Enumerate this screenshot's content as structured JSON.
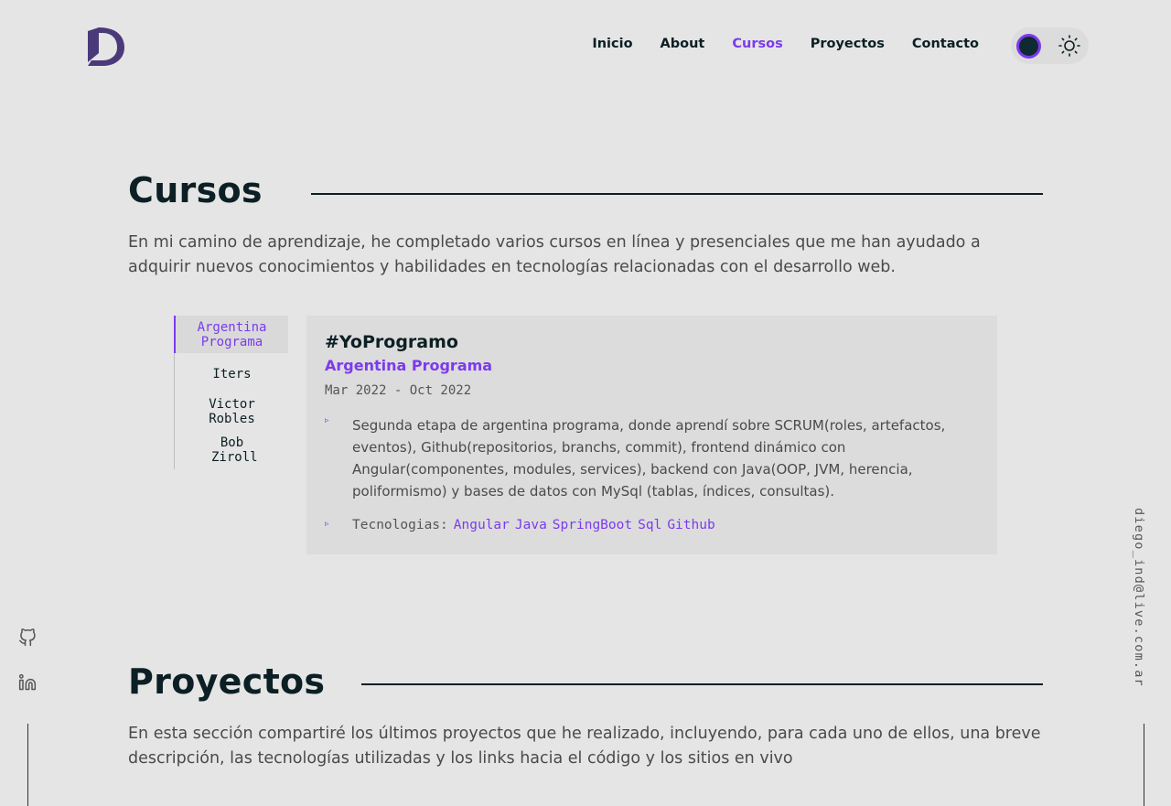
{
  "nav": {
    "items": [
      {
        "label": "Inicio"
      },
      {
        "label": "About"
      },
      {
        "label": "Cursos",
        "active": true
      },
      {
        "label": "Proyectos"
      },
      {
        "label": "Contacto"
      }
    ]
  },
  "theme": {
    "icon": "sun-icon",
    "knob_color": "#0e2a33",
    "accent": "#7c3aed"
  },
  "cursos": {
    "title": "Cursos",
    "description": "En mi camino de aprendizaje, he completado varios cursos en línea y presenciales que me han ayudado a adquirir nuevos conocimientos y habilidades en tecnologías relacionadas con el desarrollo web.",
    "tabs": [
      {
        "label": "Argentina Programa",
        "active": true
      },
      {
        "label": "Iters"
      },
      {
        "label": "Victor Robles"
      },
      {
        "label": "Bob Ziroll"
      }
    ],
    "card": {
      "title": "#YoProgramo",
      "org": "Argentina Programa",
      "date": "Mar 2022 - Oct 2022",
      "bullet": "Segunda etapa de argentina programa, donde aprendí sobre SCRUM(roles, artefactos, eventos), Github(repositorios, branchs, commit), frontend dinámico con Angular(componentes, modules, services), backend con Java(OOP, JVM, herencia, poliformismo) y bases de datos con MySql (tablas, índices, consultas).",
      "tech_label": "Tecnologias:",
      "techs": [
        "Angular",
        "Java",
        "SpringBoot",
        "Sql",
        "Github"
      ]
    }
  },
  "proyectos": {
    "title": "Proyectos",
    "description": "En esta sección compartiré los últimos proyectos que he realizado, incluyendo, para cada uno de ellos, una breve descripción, las tecnologías utilizadas y los links hacia el código y los sitios en vivo"
  },
  "side": {
    "email": "diego_ind@live.com.ar",
    "socials": [
      "github-icon",
      "linkedin-icon"
    ]
  }
}
